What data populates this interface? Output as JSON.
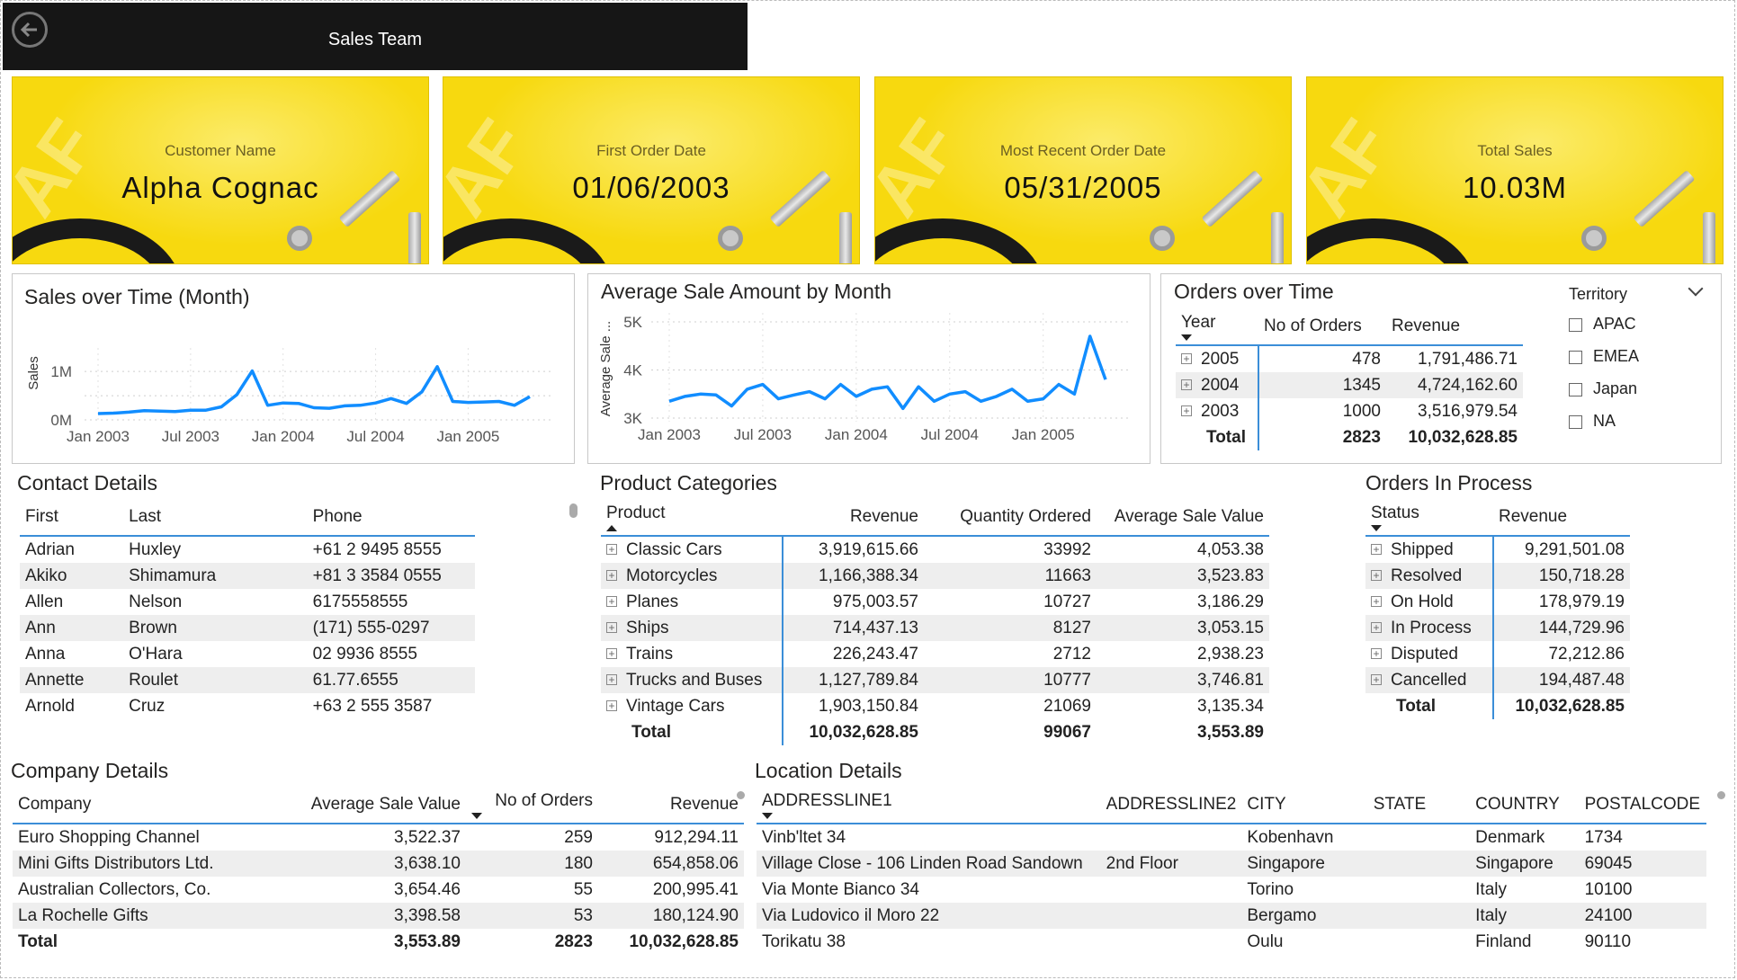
{
  "header": {
    "title": "Sales Team"
  },
  "kpis": [
    {
      "label": "Customer Name",
      "value": "Alpha Cognac"
    },
    {
      "label": "First Order Date",
      "value": "01/06/2003"
    },
    {
      "label": "Most Recent Order Date",
      "value": "05/31/2005"
    },
    {
      "label": "Total Sales",
      "value": "10.03M"
    }
  ],
  "sales_chart": {
    "title": "Sales over Time (Month)",
    "ylabel": "Sales",
    "y_ticks": [
      "1M",
      "0M"
    ],
    "x_ticks": [
      "Jan 2003",
      "Jul 2003",
      "Jan 2004",
      "Jul 2004",
      "Jan 2005"
    ]
  },
  "avg_chart": {
    "title": "Average Sale Amount by Month",
    "ylabel": "Average Sale ...",
    "y_ticks": [
      "5K",
      "4K",
      "3K"
    ],
    "x_ticks": [
      "Jan 2003",
      "Jul 2003",
      "Jan 2004",
      "Jul 2004",
      "Jan 2005"
    ]
  },
  "chart_data": [
    {
      "type": "line",
      "title": "Sales over Time (Month)",
      "ylabel": "Sales",
      "ylim": [
        0,
        1300000
      ],
      "x": [
        "2003-01",
        "2003-02",
        "2003-03",
        "2003-04",
        "2003-05",
        "2003-06",
        "2003-07",
        "2003-08",
        "2003-09",
        "2003-10",
        "2003-11",
        "2003-12",
        "2004-01",
        "2004-02",
        "2004-03",
        "2004-04",
        "2004-05",
        "2004-06",
        "2004-07",
        "2004-08",
        "2004-09",
        "2004-10",
        "2004-11",
        "2004-12",
        "2005-01",
        "2005-02",
        "2005-03",
        "2005-04",
        "2005-05"
      ],
      "values": [
        130000,
        140000,
        160000,
        190000,
        180000,
        170000,
        200000,
        200000,
        270000,
        520000,
        1010000,
        300000,
        350000,
        340000,
        250000,
        240000,
        290000,
        300000,
        350000,
        440000,
        340000,
        580000,
        1100000,
        380000,
        360000,
        370000,
        380000,
        300000,
        480000
      ],
      "color": "#118DFF"
    },
    {
      "type": "line",
      "title": "Average Sale Amount by Month",
      "ylabel": "Average Sale ...",
      "ylim": [
        3000,
        5000
      ],
      "x": [
        "2003-01",
        "2003-02",
        "2003-03",
        "2003-04",
        "2003-05",
        "2003-06",
        "2003-07",
        "2003-08",
        "2003-09",
        "2003-10",
        "2003-11",
        "2003-12",
        "2004-01",
        "2004-02",
        "2004-03",
        "2004-04",
        "2004-05",
        "2004-06",
        "2004-07",
        "2004-08",
        "2004-09",
        "2004-10",
        "2004-11",
        "2004-12",
        "2005-01",
        "2005-02",
        "2005-03",
        "2005-04",
        "2005-05"
      ],
      "values": [
        3350,
        3450,
        3500,
        3480,
        3250,
        3600,
        3700,
        3400,
        3480,
        3550,
        3400,
        3700,
        3450,
        3600,
        3650,
        3200,
        3650,
        3350,
        3500,
        3550,
        3350,
        3450,
        3600,
        3350,
        3400,
        3700,
        3500,
        4700,
        3800
      ],
      "color": "#118DFF"
    }
  ],
  "orders_over_time": {
    "title": "Orders over Time",
    "headers": [
      "Year",
      "No of Orders",
      "Revenue"
    ],
    "rows": [
      [
        "2005",
        "478",
        "1,791,486.71"
      ],
      [
        "2004",
        "1345",
        "4,724,162.60"
      ],
      [
        "2003",
        "1000",
        "3,516,979.54"
      ]
    ],
    "total": [
      "Total",
      "2823",
      "10,032,628.85"
    ]
  },
  "territory": {
    "title": "Territory",
    "options": [
      "APAC",
      "EMEA",
      "Japan",
      "NA"
    ]
  },
  "contact_details": {
    "title": "Contact Details",
    "headers": [
      "First",
      "Last",
      "Phone"
    ],
    "rows": [
      [
        "Adrian",
        "Huxley",
        "+61 2 9495 8555"
      ],
      [
        "Akiko",
        "Shimamura",
        "+81 3 3584 0555"
      ],
      [
        "Allen",
        "Nelson",
        "6175558555"
      ],
      [
        "Ann",
        "Brown",
        "(171) 555-0297"
      ],
      [
        "Anna",
        "O'Hara",
        "02 9936 8555"
      ],
      [
        "Annette",
        "Roulet",
        "61.77.6555"
      ],
      [
        "Arnold",
        "Cruz",
        "+63 2 555 3587"
      ]
    ]
  },
  "product_categories": {
    "title": "Product Categories",
    "headers": [
      "Product",
      "Revenue",
      "Quantity Ordered",
      "Average Sale Value"
    ],
    "rows": [
      [
        "Classic Cars",
        "3,919,615.66",
        "33992",
        "4,053.38"
      ],
      [
        "Motorcycles",
        "1,166,388.34",
        "11663",
        "3,523.83"
      ],
      [
        "Planes",
        "975,003.57",
        "10727",
        "3,186.29"
      ],
      [
        "Ships",
        "714,437.13",
        "8127",
        "3,053.15"
      ],
      [
        "Trains",
        "226,243.47",
        "2712",
        "2,938.23"
      ],
      [
        "Trucks and Buses",
        "1,127,789.84",
        "10777",
        "3,746.81"
      ],
      [
        "Vintage Cars",
        "1,903,150.84",
        "21069",
        "3,135.34"
      ]
    ],
    "total": [
      "Total",
      "10,032,628.85",
      "99067",
      "3,553.89"
    ]
  },
  "orders_in_process": {
    "title": "Orders In Process",
    "headers": [
      "Status",
      "Revenue"
    ],
    "rows": [
      [
        "Shipped",
        "9,291,501.08"
      ],
      [
        "Resolved",
        "150,718.28"
      ],
      [
        "On Hold",
        "178,979.19"
      ],
      [
        "In Process",
        "144,729.96"
      ],
      [
        "Disputed",
        "72,212.86"
      ],
      [
        "Cancelled",
        "194,487.48"
      ]
    ],
    "total": [
      "Total",
      "10,032,628.85"
    ]
  },
  "company_details": {
    "title": "Company Details",
    "headers": [
      "Company",
      "Average Sale Value",
      "No of Orders",
      "Revenue"
    ],
    "rows": [
      [
        "Euro Shopping Channel",
        "3,522.37",
        "259",
        "912,294.11"
      ],
      [
        "Mini Gifts Distributors Ltd.",
        "3,638.10",
        "180",
        "654,858.06"
      ],
      [
        "Australian Collectors, Co.",
        "3,654.46",
        "55",
        "200,995.41"
      ],
      [
        "La Rochelle Gifts",
        "3,398.58",
        "53",
        "180,124.90"
      ]
    ],
    "total": [
      "Total",
      "3,553.89",
      "2823",
      "10,032,628.85"
    ]
  },
  "location_details": {
    "title": "Location Details",
    "headers": [
      "ADDRESSLINE1",
      "ADDRESSLINE2",
      "CITY",
      "STATE",
      "COUNTRY",
      "POSTALCODE"
    ],
    "rows": [
      [
        "Vinb'ltet 34",
        "",
        "Kobenhavn",
        "",
        "Denmark",
        "1734"
      ],
      [
        "Village Close - 106 Linden Road Sandown",
        "2nd Floor",
        "Singapore",
        "",
        "Singapore",
        "69045"
      ],
      [
        "Via Monte Bianco 34",
        "",
        "Torino",
        "",
        "Italy",
        "10100"
      ],
      [
        "Via Ludovico il Moro 22",
        "",
        "Bergamo",
        "",
        "Italy",
        "24100"
      ],
      [
        "Torikatu 38",
        "",
        "Oulu",
        "",
        "Finland",
        "90110"
      ]
    ]
  }
}
